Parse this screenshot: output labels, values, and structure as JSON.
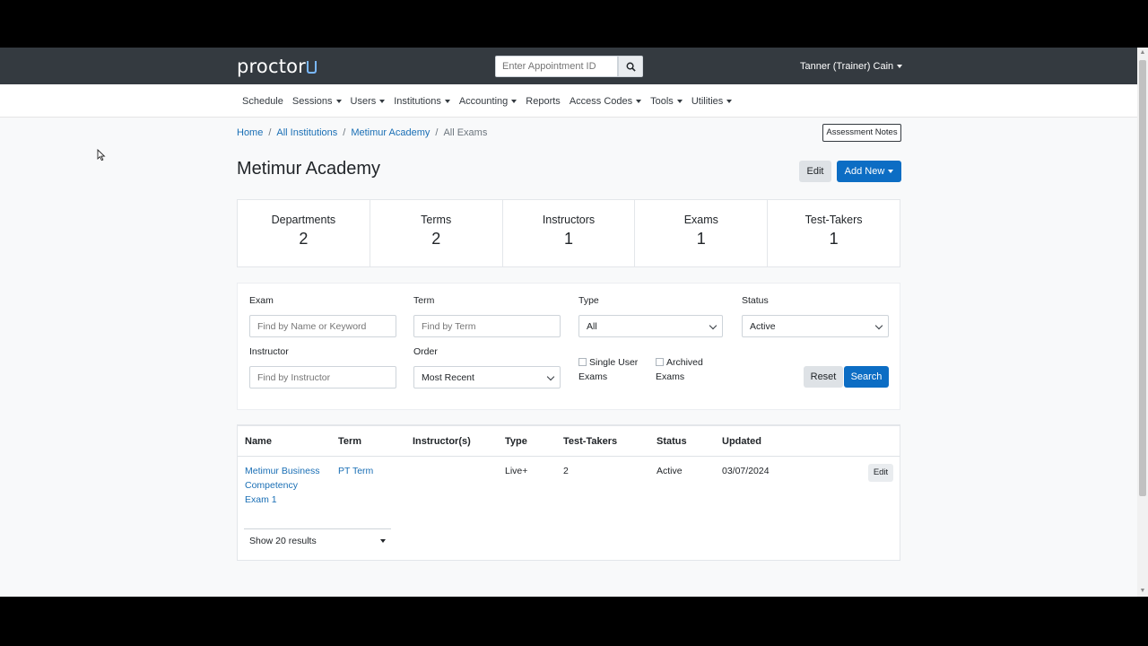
{
  "topbar": {
    "logo_text": "proctor",
    "appointment_placeholder": "Enter Appointment ID",
    "search_icon": "search-icon",
    "user_name": "Tanner (Trainer) Cain"
  },
  "nav": {
    "items": [
      {
        "label": "Schedule",
        "has_caret": false
      },
      {
        "label": "Sessions",
        "has_caret": true
      },
      {
        "label": "Users",
        "has_caret": true
      },
      {
        "label": "Institutions",
        "has_caret": true
      },
      {
        "label": "Accounting",
        "has_caret": true
      },
      {
        "label": "Reports",
        "has_caret": false
      },
      {
        "label": "Access Codes",
        "has_caret": true
      },
      {
        "label": "Tools",
        "has_caret": true
      },
      {
        "label": "Utilities",
        "has_caret": true
      }
    ]
  },
  "breadcrumb": {
    "home": "Home",
    "all_institutions": "All Institutions",
    "institution": "Metimur Academy",
    "current": "All Exams",
    "separator": "/"
  },
  "header": {
    "assessment_notes": "Assessment Notes",
    "title": "Metimur Academy",
    "edit_label": "Edit",
    "add_new_label": "Add New"
  },
  "stats": [
    {
      "label": "Departments",
      "value": "2"
    },
    {
      "label": "Terms",
      "value": "2"
    },
    {
      "label": "Instructors",
      "value": "1"
    },
    {
      "label": "Exams",
      "value": "1"
    },
    {
      "label": "Test-Takers",
      "value": "1"
    }
  ],
  "filters": {
    "exam_label": "Exam",
    "exam_placeholder": "Find by Name or Keyword",
    "term_label": "Term",
    "term_placeholder": "Find by Term",
    "type_label": "Type",
    "type_value": "All",
    "status_label": "Status",
    "status_value": "Active",
    "instructor_label": "Instructor",
    "instructor_placeholder": "Find by Instructor",
    "order_label": "Order",
    "order_value": "Most Recent",
    "single_user_line1": "Single User",
    "single_user_line2": "Exams",
    "archived_line1": "Archived",
    "archived_line2": "Exams",
    "reset_label": "Reset",
    "search_label": "Search"
  },
  "table": {
    "headers": [
      "Name",
      "Term",
      "Instructor(s)",
      "Type",
      "Test-Takers",
      "Status",
      "Updated"
    ],
    "rows": [
      {
        "name_line1": "Metimur Business",
        "name_line2": "Competency",
        "name_line3": "Exam 1",
        "term": "PT Term",
        "instructors": "",
        "type": "Live+",
        "test_takers": "2",
        "status": "Active",
        "updated": "03/07/2024",
        "edit_label": "Edit"
      }
    ],
    "page_size": "Show 20 results"
  }
}
